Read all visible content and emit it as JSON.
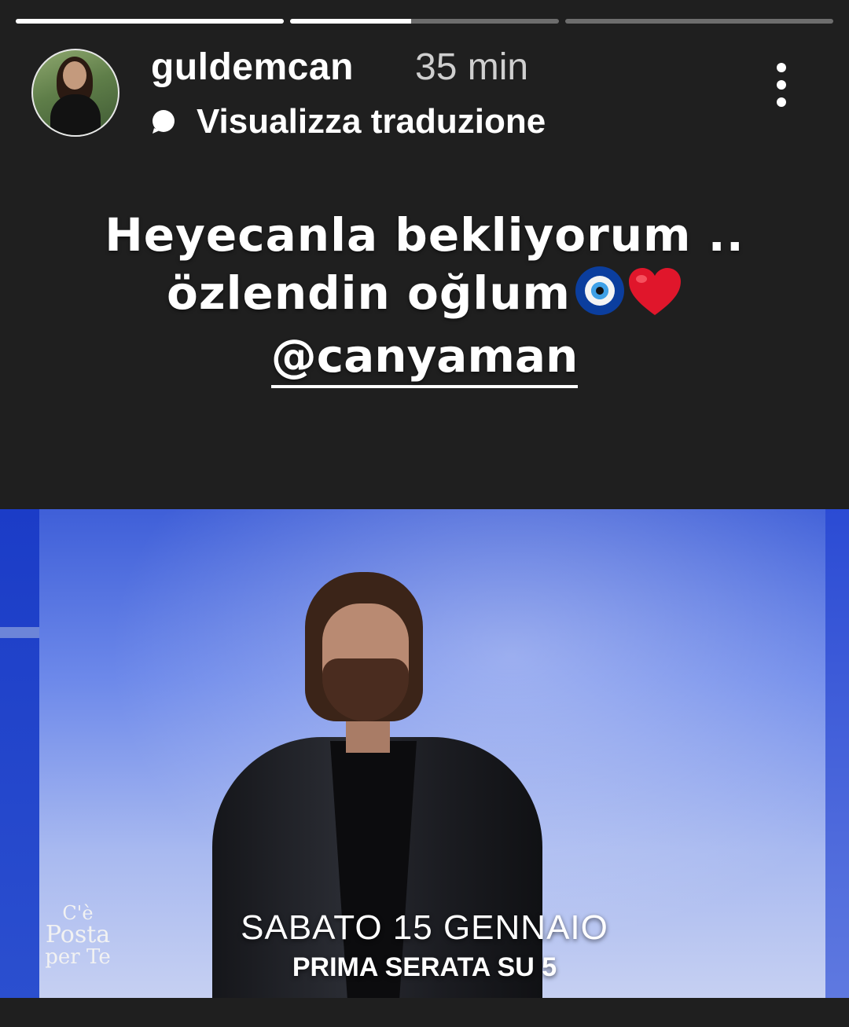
{
  "story": {
    "progress": [
      1.0,
      0.45,
      0.0
    ],
    "username": "guldemcan",
    "time_ago": "35 min",
    "translate_label": "Visualizza traduzione",
    "more_icon": "more-vertical-icon"
  },
  "caption": {
    "line1": "Heyecanla bekliyorum ..",
    "line2": "özlendin oğlum",
    "emoji1": "nazar-eye-emoji",
    "emoji2": "red-heart-emoji",
    "mention": "@canyaman"
  },
  "video": {
    "logo_line1": "C'è",
    "logo_line2": "Posta",
    "logo_line3": "per Te",
    "date_text": "SABATO 15 GENNAIO",
    "slot_text": "PRIMA SERATA SU",
    "channel": "5"
  }
}
